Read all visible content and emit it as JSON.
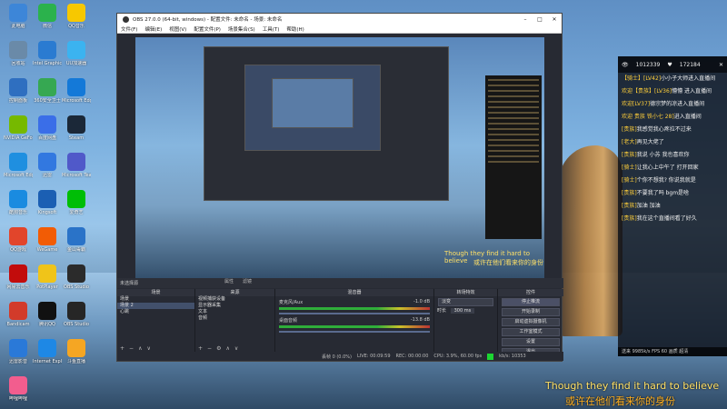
{
  "desktop": {
    "icons": [
      {
        "label": "此电脑",
        "color": "#3d86d8"
      },
      {
        "label": "微信",
        "color": "#2bb24c"
      },
      {
        "label": "QQ音乐",
        "color": "#f7c800"
      },
      {
        "label": "回收站",
        "color": "#6a8aa8"
      },
      {
        "label": "Intel Graphics Control",
        "color": "#2a7bd1"
      },
      {
        "label": "UU加速器",
        "color": "#3bb3f0"
      },
      {
        "label": "控制面板",
        "color": "#2f6fc0"
      },
      {
        "label": "360安全卫士",
        "color": "#36a852"
      },
      {
        "label": "Microsoft Edge",
        "color": "#1479d8"
      },
      {
        "label": "NVIDIA GeForce Experience",
        "color": "#76b900"
      },
      {
        "label": "百度网盘",
        "color": "#3a6ee8"
      },
      {
        "label": "Steam",
        "color": "#1b2838"
      },
      {
        "label": "Microsoft Edge",
        "color": "#1f8fe0"
      },
      {
        "label": "迅雷",
        "color": "#3278e0"
      },
      {
        "label": "Microsoft Teams",
        "color": "#5059c9"
      },
      {
        "label": "酷狗音乐",
        "color": "#1a8be0"
      },
      {
        "label": "Kingsoft",
        "color": "#1b5fb3"
      },
      {
        "label": "爱奇艺",
        "color": "#00be06"
      },
      {
        "label": "QQ游戏",
        "color": "#e2452b"
      },
      {
        "label": "WeGame",
        "color": "#f25c05"
      },
      {
        "label": "金山毒霸",
        "color": "#2a73c8"
      },
      {
        "label": "网易云音乐",
        "color": "#c20c0c"
      },
      {
        "label": "PotPlayer",
        "color": "#f0c419"
      },
      {
        "label": "OBS Studio",
        "color": "#2b2b2b"
      },
      {
        "label": "Bandicam",
        "color": "#d23b2a"
      },
      {
        "label": "腾讯QQ",
        "color": "#111111"
      },
      {
        "label": "OBS Studio",
        "color": "#262626"
      },
      {
        "label": "迅雷影音",
        "color": "#2a79d8"
      },
      {
        "label": "Internet Explorer",
        "color": "#1e88e5"
      },
      {
        "label": "斗鱼直播",
        "color": "#f5a623"
      },
      {
        "label": "哔哩哔哩",
        "color": "#f25d8e"
      }
    ]
  },
  "obs": {
    "title": "OBS 27.0.0 (64-bit, windows) - 配置文件: 未命名 - 场景: 未命名",
    "menu": [
      "文件(F)",
      "编辑(E)",
      "视图(V)",
      "配置文件(P)",
      "场景集合(S)",
      "工具(T)",
      "帮助(H)"
    ],
    "no_source_selected": "未选择源",
    "dock_tabs": [
      "属性",
      "滤镜"
    ],
    "scenes_header": "场景",
    "scenes": [
      "场景",
      "场景 2",
      "心跳"
    ],
    "sources_header": "来源",
    "sources": [
      "视频捕获设备",
      "显示器采集",
      "文本",
      "音频"
    ],
    "mixer_header": "混音器",
    "mixer": [
      {
        "name": "麦克风/Aux",
        "db": "-1.0 dB"
      },
      {
        "name": "桌面音频",
        "db": "-13.8 dB"
      }
    ],
    "transitions_header": "转场特效",
    "transition_type": "淡变",
    "transition_duration_label": "时长",
    "transition_duration": "300 ms",
    "controls_header": "控件",
    "controls": [
      "停止推流",
      "开始录制",
      "启动虚拟摄像机",
      "工作室模式",
      "设置",
      "退出"
    ],
    "status": {
      "dropped": "丢帧 0 (0.0%)",
      "live": "LIVE: 00:09:59",
      "rec": "REC: 00:00:00",
      "cpu": "CPU: 3.9%, 60.00 fps",
      "kbps": "kb/s: 10353"
    },
    "preview_subtitle_1": "Though they find it hard to believe",
    "preview_subtitle_2": "或许在他们看来你的身份"
  },
  "chat": {
    "viewers": "1012339",
    "likes": "172184",
    "messages": [
      {
        "user": "【骑士】[LV42]",
        "text": "小小子大师进入直播间"
      },
      {
        "user": "欢迎【贵族】[LV36]",
        "text": "懵懵 进入直播间"
      },
      {
        "user": "欢迎[LV37]",
        "text": "德宗梦的凉进入直播间"
      },
      {
        "user": "欢迎 贵族 铁小七 28]",
        "text": "进入直播间"
      },
      {
        "user": "[贵族]",
        "text": "我感觉我心疼拉不过来"
      },
      {
        "user": "[老大]",
        "text": "再见大佬了"
      },
      {
        "user": "[贵族]",
        "text": "我说 小苏 我也喜欢你"
      },
      {
        "user": "[骑士]",
        "text": "让我心上中午了 打开回家"
      },
      {
        "user": "[骑士]",
        "text": "个你不想我? 你说我就是"
      },
      {
        "user": "[贵族]",
        "text": "不要我了吗 bgm是啥"
      },
      {
        "user": "[贵族]",
        "text": "加油 加油"
      },
      {
        "user": "[贵族]",
        "text": "我在这个直播间看了好久"
      }
    ],
    "footer": "送来 9985k/s FPS 60 画质 超清"
  },
  "subtitle": {
    "line1": "Though they find it hard to believe",
    "line2": "或许在他们看来你的身份"
  }
}
